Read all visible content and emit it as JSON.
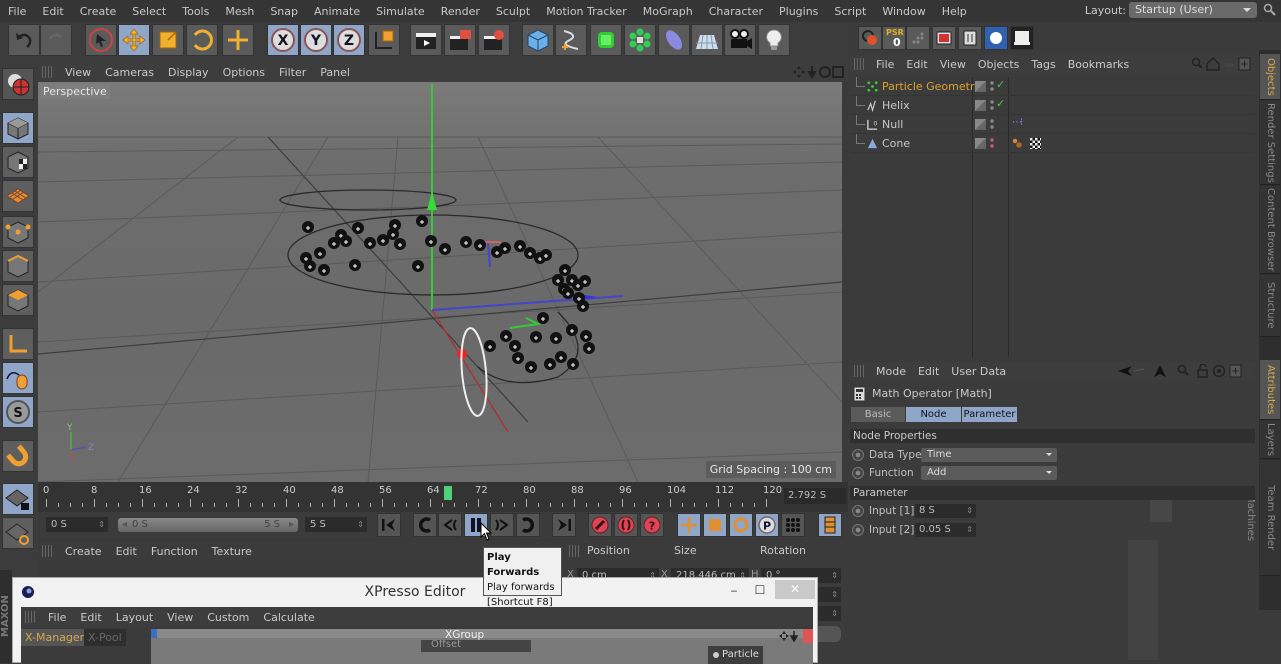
{
  "menubar": {
    "items": [
      "File",
      "Edit",
      "Create",
      "Select",
      "Tools",
      "Mesh",
      "Snap",
      "Animate",
      "Simulate",
      "Render",
      "Sculpt",
      "Motion Tracker",
      "MoGraph",
      "Character",
      "Plugins",
      "Script",
      "Window",
      "Help"
    ],
    "layout_label": "Layout:",
    "layout_value": "Startup (User)"
  },
  "toolbar": {
    "icons": [
      "undo-icon",
      "redo-icon",
      "live-selection-icon",
      "move-icon",
      "scale-icon",
      "rotate-icon",
      "add-icon",
      "x-axis-icon",
      "y-axis-icon",
      "z-axis-icon",
      "coordinate-system-icon",
      "render-view-icon",
      "render-picture-viewer-icon",
      "render-settings-icon",
      "cube-icon",
      "spline-pen-icon",
      "subdivision-icon",
      "cloner-icon",
      "deformer-icon",
      "floor-icon",
      "camera-icon",
      "light-icon"
    ],
    "psr_label": "PSR",
    "psr_value": "0"
  },
  "left_toolbar": {
    "icons": [
      "model-mode-icon",
      "texture-mode-icon",
      "workplane-mode-icon",
      "points-mode-icon",
      "edges-mode-icon",
      "polygons-mode-icon",
      "axis-mode-icon",
      "tweak-mode-icon",
      "solo-icon",
      "snap-icon",
      "workplane-lock-icon",
      "workplane-align-icon"
    ]
  },
  "viewport": {
    "menu": [
      "View",
      "Cameras",
      "Display",
      "Options",
      "Filter",
      "Panel"
    ],
    "camera_label": "Perspective",
    "grid_spacing": "Grid Spacing : 100 cm",
    "axis_labels": {
      "y": "Y",
      "z": "Z"
    }
  },
  "timeline": {
    "ticks": [
      "0",
      "8",
      "16",
      "24",
      "32",
      "40",
      "48",
      "56",
      "64",
      "72",
      "80",
      "88",
      "96",
      "104",
      "112",
      "120"
    ],
    "current_frame": 67,
    "current_time": "2.792 S",
    "start_field": "0 S",
    "range_start": "0 S",
    "range_end": "5 S",
    "end_field": "5 S"
  },
  "tooltip": {
    "title": "Play Forwards",
    "desc": "Play forwards",
    "shortcut": "[Shortcut F8]"
  },
  "xpresso_menu": [
    "Create",
    "Edit",
    "Function",
    "Texture"
  ],
  "coordinates": {
    "headers": [
      "Position",
      "Size",
      "Rotation"
    ],
    "row1": {
      "pos_axis": "X",
      "pos": "0 cm",
      "size_axis": "X",
      "size": "218.446 cm",
      "rot_axis": "H",
      "rot": "0 °"
    }
  },
  "xpresso_window": {
    "title": "XPresso Editor",
    "menu": [
      "File",
      "Edit",
      "Layout",
      "View",
      "Custom",
      "Calculate"
    ],
    "tabs": [
      "X-Manager",
      "X-Pool"
    ],
    "group_title": "XGroup",
    "node_port": "Offset",
    "node_label": "Particle",
    "minimize": "‒",
    "maximize": "☐",
    "close": "✕"
  },
  "object_manager": {
    "menu": [
      "File",
      "Edit",
      "View",
      "Objects",
      "Tags",
      "Bookmarks"
    ],
    "objects": [
      {
        "name": "Particle Geometry",
        "selected": true,
        "check": true
      },
      {
        "name": "Helix",
        "selected": false,
        "check": true
      },
      {
        "name": "Null",
        "selected": false,
        "check": false
      },
      {
        "name": "Cone",
        "selected": false,
        "check": false
      }
    ]
  },
  "side_tabs_top": [
    "Objects",
    "Render Settings",
    "Content Browser",
    "Structure"
  ],
  "side_tabs_bottom": [
    "Attributes",
    "Layers",
    "Team Render Machines"
  ],
  "attributes": {
    "menu": [
      "Mode",
      "Edit",
      "User Data"
    ],
    "title": "Math Operator [Math]",
    "tabs": [
      "Basic",
      "Node",
      "Parameter"
    ],
    "section1": "Node Properties",
    "data_type_label": "Data Type",
    "data_type_value": "Time",
    "function_label": "Function",
    "function_value": "Add",
    "section2": "Parameter",
    "input1_label": "Input [1]",
    "input1_value": "8 S",
    "input2_label": "Input [2]",
    "input2_value": "0.05 S"
  },
  "brand": "MAXON"
}
